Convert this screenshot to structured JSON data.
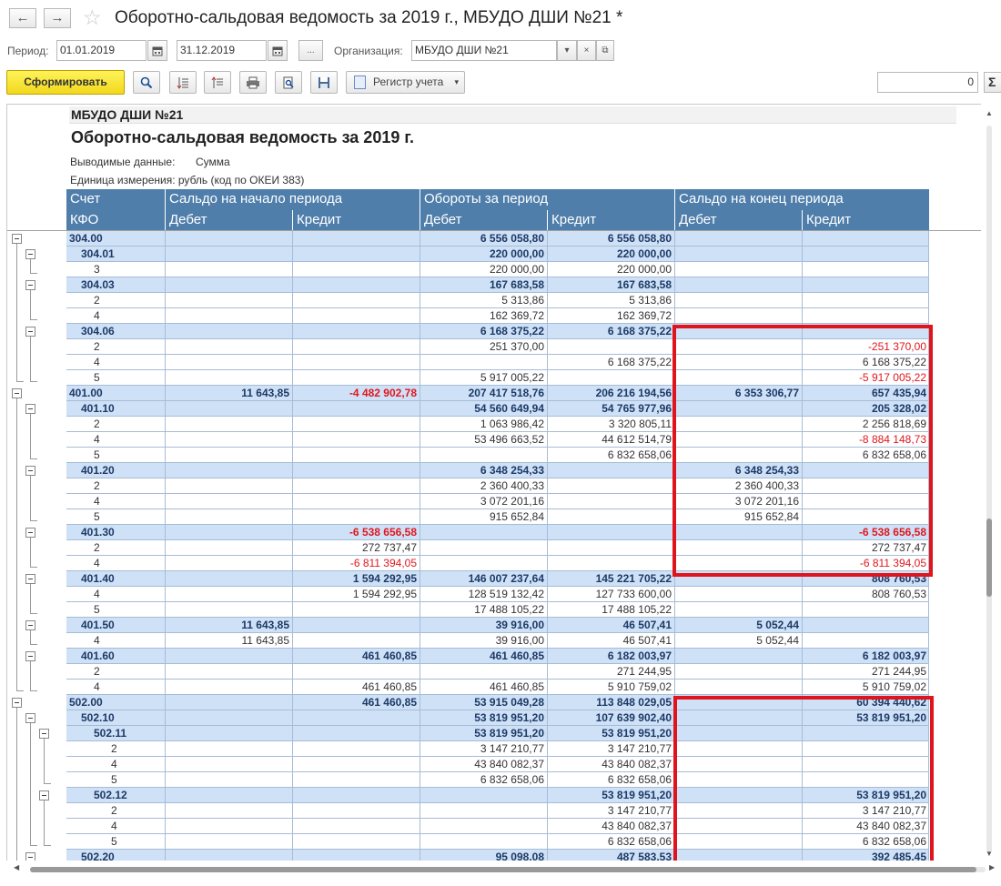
{
  "window": {
    "title": "Оборотно-сальдовая ведомость за 2019 г., МБУДО ДШИ  №21 *",
    "back_icon": "←",
    "forward_icon": "→",
    "star_icon": "☆"
  },
  "period": {
    "label": "Период:",
    "from": "01.01.2019",
    "to": "31.12.2019",
    "dots": "...",
    "org_label": "Организация:",
    "org": "МБУДО ДШИ  №21"
  },
  "toolbar": {
    "generate": "Сформировать",
    "register": "Регистр учета",
    "sum_value": "0",
    "sigma": "Σ"
  },
  "report": {
    "org": "МБУДО ДШИ  №21",
    "title": "Оборотно-сальдовая ведомость за 2019 г.",
    "output_label": "Выводимые данные:",
    "output_value": "Сумма",
    "unit": "Единица измерения: рубль (код по ОКЕИ 383)",
    "header": {
      "account": "Счет",
      "opening": "Сальдо на начало периода",
      "turnover": "Обороты за период",
      "closing": "Сальдо на конец периода",
      "kfo": "КФО",
      "debit": "Дебет",
      "credit": "Кредит"
    },
    "rows": [
      {
        "acc": "304.00",
        "lvl": 0,
        "g": true,
        "v": [
          "",
          "",
          "6 556 058,80",
          "6 556 058,80",
          "",
          ""
        ]
      },
      {
        "acc": "304.01",
        "lvl": 1,
        "g": true,
        "v": [
          "",
          "",
          "220 000,00",
          "220 000,00",
          "",
          ""
        ]
      },
      {
        "acc": "3",
        "lvl": 2,
        "g": false,
        "v": [
          "",
          "",
          "220 000,00",
          "220 000,00",
          "",
          ""
        ]
      },
      {
        "acc": "304.03",
        "lvl": 1,
        "g": true,
        "v": [
          "",
          "",
          "167 683,58",
          "167 683,58",
          "",
          ""
        ]
      },
      {
        "acc": "2",
        "lvl": 2,
        "g": false,
        "v": [
          "",
          "",
          "5 313,86",
          "5 313,86",
          "",
          ""
        ]
      },
      {
        "acc": "4",
        "lvl": 2,
        "g": false,
        "v": [
          "",
          "",
          "162 369,72",
          "162 369,72",
          "",
          ""
        ]
      },
      {
        "acc": "304.06",
        "lvl": 1,
        "g": true,
        "v": [
          "",
          "",
          "6 168 375,22",
          "6 168 375,22",
          "",
          ""
        ]
      },
      {
        "acc": "2",
        "lvl": 2,
        "g": false,
        "v": [
          "",
          "",
          "251 370,00",
          "",
          "",
          "-251 370,00"
        ]
      },
      {
        "acc": "4",
        "lvl": 2,
        "g": false,
        "v": [
          "",
          "",
          "",
          "6 168 375,22",
          "",
          "6 168 375,22"
        ]
      },
      {
        "acc": "5",
        "lvl": 2,
        "g": false,
        "v": [
          "",
          "",
          "5 917 005,22",
          "",
          "",
          "-5 917 005,22"
        ]
      },
      {
        "acc": "401.00",
        "lvl": 0,
        "g": true,
        "v": [
          "11 643,85",
          "-4 482 902,78",
          "207 417 518,76",
          "206 216 194,56",
          "6 353 306,77",
          "657 435,94"
        ]
      },
      {
        "acc": "401.10",
        "lvl": 1,
        "g": true,
        "v": [
          "",
          "",
          "54 560 649,94",
          "54 765 977,96",
          "",
          "205 328,02"
        ]
      },
      {
        "acc": "2",
        "lvl": 2,
        "g": false,
        "v": [
          "",
          "",
          "1 063 986,42",
          "3 320 805,11",
          "",
          "2 256 818,69"
        ]
      },
      {
        "acc": "4",
        "lvl": 2,
        "g": false,
        "v": [
          "",
          "",
          "53 496 663,52",
          "44 612 514,79",
          "",
          "-8 884 148,73"
        ]
      },
      {
        "acc": "5",
        "lvl": 2,
        "g": false,
        "v": [
          "",
          "",
          "",
          "6 832 658,06",
          "",
          "6 832 658,06"
        ]
      },
      {
        "acc": "401.20",
        "lvl": 1,
        "g": true,
        "v": [
          "",
          "",
          "6 348 254,33",
          "",
          "6 348 254,33",
          ""
        ]
      },
      {
        "acc": "2",
        "lvl": 2,
        "g": false,
        "v": [
          "",
          "",
          "2 360 400,33",
          "",
          "2 360 400,33",
          ""
        ]
      },
      {
        "acc": "4",
        "lvl": 2,
        "g": false,
        "v": [
          "",
          "",
          "3 072 201,16",
          "",
          "3 072 201,16",
          ""
        ]
      },
      {
        "acc": "5",
        "lvl": 2,
        "g": false,
        "v": [
          "",
          "",
          "915 652,84",
          "",
          "915 652,84",
          ""
        ]
      },
      {
        "acc": "401.30",
        "lvl": 1,
        "g": true,
        "v": [
          "",
          "-6 538 656,58",
          "",
          "",
          "",
          "-6 538 656,58"
        ]
      },
      {
        "acc": "2",
        "lvl": 2,
        "g": false,
        "v": [
          "",
          "272 737,47",
          "",
          "",
          "",
          "272 737,47"
        ]
      },
      {
        "acc": "4",
        "lvl": 2,
        "g": false,
        "v": [
          "",
          "-6 811 394,05",
          "",
          "",
          "",
          "-6 811 394,05"
        ]
      },
      {
        "acc": "401.40",
        "lvl": 1,
        "g": true,
        "v": [
          "",
          "1 594 292,95",
          "146 007 237,64",
          "145 221 705,22",
          "",
          "808 760,53"
        ]
      },
      {
        "acc": "4",
        "lvl": 2,
        "g": false,
        "v": [
          "",
          "1 594 292,95",
          "128 519 132,42",
          "127 733 600,00",
          "",
          "808 760,53"
        ]
      },
      {
        "acc": "5",
        "lvl": 2,
        "g": false,
        "v": [
          "",
          "",
          "17 488 105,22",
          "17 488 105,22",
          "",
          ""
        ]
      },
      {
        "acc": "401.50",
        "lvl": 1,
        "g": true,
        "v": [
          "11 643,85",
          "",
          "39 916,00",
          "46 507,41",
          "5 052,44",
          ""
        ]
      },
      {
        "acc": "4",
        "lvl": 2,
        "g": false,
        "v": [
          "11 643,85",
          "",
          "39 916,00",
          "46 507,41",
          "5 052,44",
          ""
        ]
      },
      {
        "acc": "401.60",
        "lvl": 1,
        "g": true,
        "v": [
          "",
          "461 460,85",
          "461 460,85",
          "6 182 003,97",
          "",
          "6 182 003,97"
        ]
      },
      {
        "acc": "2",
        "lvl": 2,
        "g": false,
        "v": [
          "",
          "",
          "",
          "271 244,95",
          "",
          "271 244,95"
        ]
      },
      {
        "acc": "4",
        "lvl": 2,
        "g": false,
        "v": [
          "",
          "461 460,85",
          "461 460,85",
          "5 910 759,02",
          "",
          "5 910 759,02"
        ]
      },
      {
        "acc": "502.00",
        "lvl": 0,
        "g": true,
        "v": [
          "",
          "461 460,85",
          "53 915 049,28",
          "113 848 029,05",
          "",
          "60 394 440,62"
        ]
      },
      {
        "acc": "502.10",
        "lvl": 1,
        "g": true,
        "v": [
          "",
          "",
          "53 819 951,20",
          "107 639 902,40",
          "",
          "53 819 951,20"
        ]
      },
      {
        "acc": "502.11",
        "lvl": 2,
        "g": true,
        "v": [
          "",
          "",
          "53 819 951,20",
          "53 819 951,20",
          "",
          ""
        ]
      },
      {
        "acc": "2",
        "lvl": 3,
        "g": false,
        "v": [
          "",
          "",
          "3 147 210,77",
          "3 147 210,77",
          "",
          ""
        ]
      },
      {
        "acc": "4",
        "lvl": 3,
        "g": false,
        "v": [
          "",
          "",
          "43 840 082,37",
          "43 840 082,37",
          "",
          ""
        ]
      },
      {
        "acc": "5",
        "lvl": 3,
        "g": false,
        "v": [
          "",
          "",
          "6 832 658,06",
          "6 832 658,06",
          "",
          ""
        ]
      },
      {
        "acc": "502.12",
        "lvl": 2,
        "g": true,
        "v": [
          "",
          "",
          "",
          "53 819 951,20",
          "",
          "53 819 951,20"
        ]
      },
      {
        "acc": "2",
        "lvl": 3,
        "g": false,
        "v": [
          "",
          "",
          "",
          "3 147 210,77",
          "",
          "3 147 210,77"
        ]
      },
      {
        "acc": "4",
        "lvl": 3,
        "g": false,
        "v": [
          "",
          "",
          "",
          "43 840 082,37",
          "",
          "43 840 082,37"
        ]
      },
      {
        "acc": "5",
        "lvl": 3,
        "g": false,
        "v": [
          "",
          "",
          "",
          "6 832 658,06",
          "",
          "6 832 658,06"
        ]
      },
      {
        "acc": "502.20",
        "lvl": 1,
        "g": true,
        "v": [
          "",
          "",
          "95 098,08",
          "487 583,53",
          "",
          "392 485,45"
        ]
      }
    ]
  },
  "colors": {
    "header_bg": "#4f7eab",
    "group_row_bg": "#cfe1f7",
    "negative": "#e0171d",
    "highlight_box": "#e0141c",
    "generate_button": "#f7e02a"
  }
}
